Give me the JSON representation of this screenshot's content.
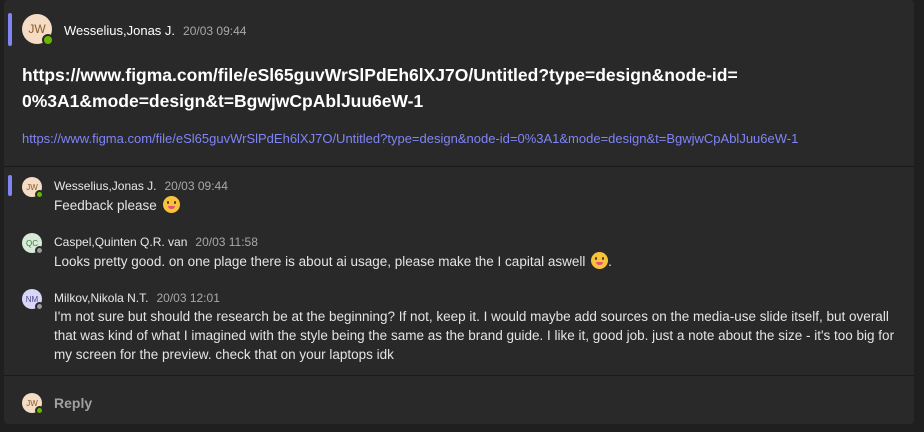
{
  "post": {
    "author": "Wesselius,Jonas J.",
    "initials": "JW",
    "time": "20/03 09:44",
    "title": "https://www.figma.com/file/eSl65guvWrSlPdEh6lXJ7O/Untitled?type=design&node-id=0%3A1&mode=design&t=BgwjwCpAblJuu6eW-1",
    "link": "https://www.figma.com/file/eSl65guvWrSlPdEh6lXJ7O/Untitled?type=design&node-id=0%3A1&mode=design&t=BgwjwCpAblJuu6eW-1"
  },
  "replies": [
    {
      "author": "Wesselius,Jonas J.",
      "initials": "JW",
      "time": "20/03 09:44",
      "text": "Feedback please"
    },
    {
      "author": "Caspel,Quinten Q.R. van",
      "initials": "QC",
      "time": "20/03 11:58",
      "text": "Looks pretty good. on one plage there is about ai usage, please make the I capital aswell"
    },
    {
      "author": "Milkov,Nikola N.T.",
      "initials": "NM",
      "time": "20/03 12:01",
      "text": "I'm not sure but should the research be at the beginning? If not, keep it. I would maybe add sources on the media-use slide itself, but overall that was kind of what I imagined with the style being the same as the brand guide. I like it, good job. just a note about the size - it's too big for my screen for the preview. check that on your laptops idk"
    }
  ],
  "reply_box": {
    "initials": "JW",
    "label": "Reply"
  },
  "emoji": [
    "smiling-face-emoji"
  ],
  "colors": {
    "accent": "#7f85f5",
    "presence_available": "#6bb700",
    "presence_away": "#9a9a9a"
  }
}
